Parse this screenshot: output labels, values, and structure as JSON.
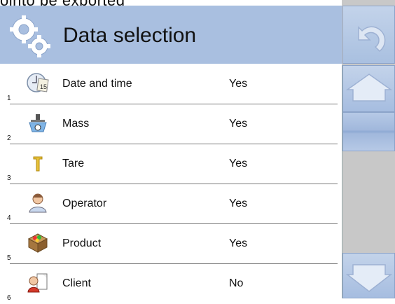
{
  "top_cutoff_text": "ointo be exported",
  "header": {
    "title": "Data selection"
  },
  "rows": [
    {
      "number": "1",
      "label": "Date and time",
      "value": "Yes",
      "icon": "clock-calendar-icon"
    },
    {
      "number": "2",
      "label": "Mass",
      "value": "Yes",
      "icon": "scale-icon"
    },
    {
      "number": "3",
      "label": "Tare",
      "value": "Yes",
      "icon": "tare-icon"
    },
    {
      "number": "4",
      "label": "Operator",
      "value": "Yes",
      "icon": "operator-icon"
    },
    {
      "number": "5",
      "label": "Product",
      "value": "Yes",
      "icon": "product-box-icon"
    },
    {
      "number": "6",
      "label": "Client",
      "value": "No",
      "icon": "client-icon"
    }
  ],
  "colors": {
    "header_bg": "#a9bfe0",
    "button_blue": "#b6c9e6",
    "panel_gray": "#c8c8c8"
  }
}
